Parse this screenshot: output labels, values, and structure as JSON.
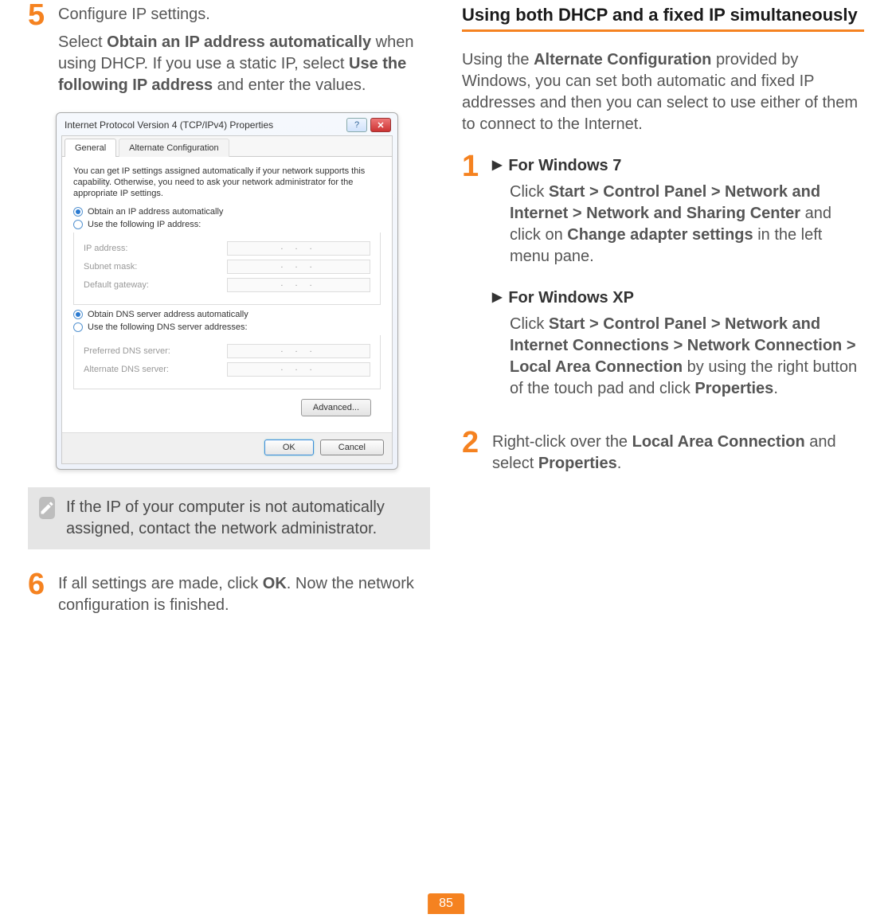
{
  "left": {
    "step5_num": "5",
    "step5_line1": "Configure IP settings.",
    "step5_para_a": "Select ",
    "step5_bold1": "Obtain an IP address automatically",
    "step5_para_b": " when using DHCP. If you use a static IP, select ",
    "step5_bold2": "Use the following IP address",
    "step5_para_c": " and enter the values.",
    "note": "If the IP of your computer is not automatically assigned, contact the network administrator.",
    "step6_num": "6",
    "step6_a": "If all settings are made, click ",
    "step6_bold": "OK",
    "step6_b": ". Now the network configuration is finished."
  },
  "dialog": {
    "title": "Internet Protocol Version 4 (TCP/IPv4) Properties",
    "help": "?",
    "close": "✕",
    "tab_general": "General",
    "tab_alt": "Alternate Configuration",
    "desc": "You can get IP settings assigned automatically if your network supports this capability. Otherwise, you need to ask your network administrator for the appropriate IP settings.",
    "r1": "Obtain an IP address automatically",
    "r2": "Use the following IP address:",
    "f_ip": "IP address:",
    "f_mask": "Subnet mask:",
    "f_gw": "Default gateway:",
    "r3": "Obtain DNS server address automatically",
    "r4": "Use the following DNS server addresses:",
    "f_pdns": "Preferred DNS server:",
    "f_adns": "Alternate DNS server:",
    "dots": ".   .   .",
    "advanced": "Advanced...",
    "ok": "OK",
    "cancel": "Cancel"
  },
  "right": {
    "h1": "Using both DHCP and a fixed IP simultaneously",
    "p1_a": "Using the ",
    "p1_bold": "Alternate Configuration",
    "p1_b": " provided by Windows, you can set both automatic and fixed IP addresses and then you can select to use either of them to connect to the Internet.",
    "s1_num": "1",
    "w7_h": "For Windows 7",
    "w7_a": "Click ",
    "w7_bold1": "Start > Control Panel > Network and Internet > Network and Sharing Center",
    "w7_b": " and click on ",
    "w7_bold2": "Change adapter settings",
    "w7_c": " in the left menu pane.",
    "wxp_h": "For Windows XP",
    "wxp_a": "Click ",
    "wxp_bold1": "Start > Control Panel > Network and Internet Connections > Network Connection > Local Area Connection",
    "wxp_b": " by using the right button of the touch pad and click ",
    "wxp_bold2": "Properties",
    "wxp_c": ".",
    "s2_num": "2",
    "s2_a": "Right-click over the ",
    "s2_bold1": "Local Area Connection",
    "s2_b": " and select ",
    "s2_bold2": "Properties",
    "s2_c": "."
  },
  "page": "85"
}
